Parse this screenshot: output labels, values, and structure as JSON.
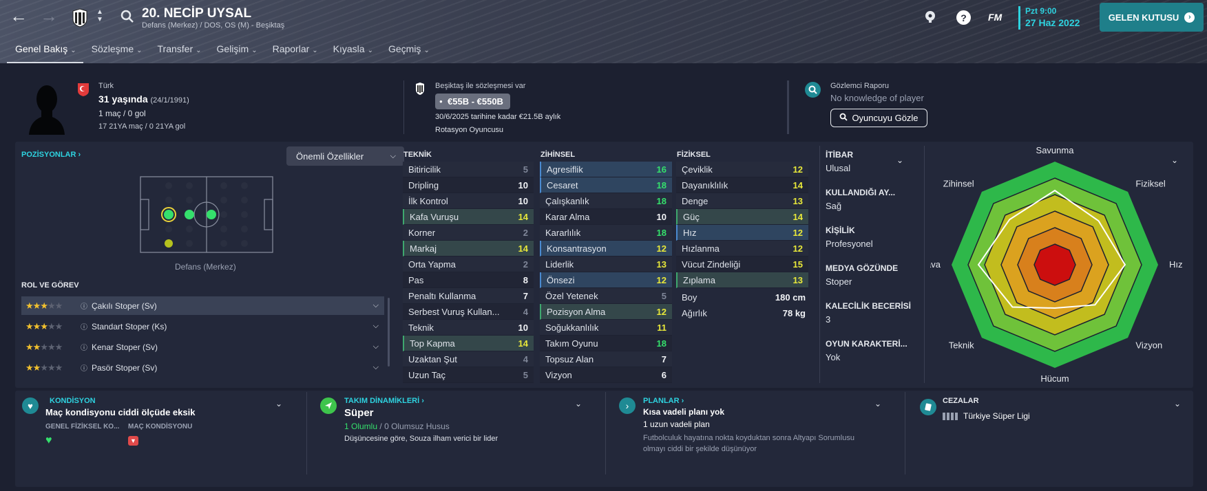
{
  "header": {
    "player_title": "20. NECİP UYSAL",
    "player_subtitle": "Defans (Merkez) / DOS, OS (M) - Beşiktaş",
    "tabs": [
      "Genel Bakış",
      "Sözleşme",
      "Transfer",
      "Gelişim",
      "Raporlar",
      "Kıyasla",
      "Geçmiş"
    ],
    "fm_label": "FM",
    "date_line1": "Pzt 9:00",
    "date_line2": "27 Haz 2022",
    "inbox_label": "GELEN KUTUSU"
  },
  "profile": {
    "nationality": "Türk",
    "age": "31 yaşında",
    "birth": "(24/1/1991)",
    "caps": "1 maç / 0 gol",
    "u21": "17 21YA maç / 0 21YA gol"
  },
  "contract": {
    "text": "Beşiktaş ile sözleşmesi var",
    "value_range": "€55B - €550B",
    "wage": "30/6/2025 tarihine kadar €21.5B aylık",
    "role": "Rotasyon Oyuncusu"
  },
  "scout": {
    "title": "Gözlemci Raporu",
    "text": "No knowledge of player",
    "button": "Oyuncuyu Gözle"
  },
  "positions": {
    "title": "POZİSYONLAR",
    "dropdown": "Önemli Özellikler",
    "pitch_caption": "Defans (Merkez)",
    "roles_title": "ROL VE GÖREV",
    "roles": [
      {
        "name": "Çakılı Stoper (Sv)",
        "stars": 2.5
      },
      {
        "name": "Standart Stoper (Ks)",
        "stars": 2.5
      },
      {
        "name": "Kenar Stoper (Sv)",
        "stars": 2
      },
      {
        "name": "Pasör Stoper (Sv)",
        "stars": 2
      }
    ]
  },
  "teknik": {
    "title": "TEKNİK",
    "rows": [
      {
        "name": "Bitiricilik",
        "value": "5",
        "hl": "plain"
      },
      {
        "name": "Dripling",
        "value": "10",
        "hl": "alt"
      },
      {
        "name": "İlk Kontrol",
        "value": "10",
        "hl": "plain"
      },
      {
        "name": "Kafa Vuruşu",
        "value": "14",
        "hl": "green"
      },
      {
        "name": "Korner",
        "value": "2",
        "hl": "plain"
      },
      {
        "name": "Markaj",
        "value": "14",
        "hl": "green"
      },
      {
        "name": "Orta Yapma",
        "value": "2",
        "hl": "plain"
      },
      {
        "name": "Pas",
        "value": "8",
        "hl": "alt"
      },
      {
        "name": "Penaltı Kullanma",
        "value": "7",
        "hl": "plain"
      },
      {
        "name": "Serbest Vuruş Kullan...",
        "value": "4",
        "hl": "alt"
      },
      {
        "name": "Teknik",
        "value": "10",
        "hl": "plain"
      },
      {
        "name": "Top Kapma",
        "value": "14",
        "hl": "green"
      },
      {
        "name": "Uzaktan Şut",
        "value": "4",
        "hl": "plain"
      },
      {
        "name": "Uzun Taç",
        "value": "5",
        "hl": "alt"
      }
    ]
  },
  "zihinsel": {
    "title": "ZİHİNSEL",
    "rows": [
      {
        "name": "Agresiflik",
        "value": "16",
        "hl": "blue"
      },
      {
        "name": "Cesaret",
        "value": "18",
        "hl": "blue"
      },
      {
        "name": "Çalışkanlık",
        "value": "18",
        "hl": "plain"
      },
      {
        "name": "Karar Alma",
        "value": "10",
        "hl": "alt"
      },
      {
        "name": "Kararlılık",
        "value": "18",
        "hl": "plain"
      },
      {
        "name": "Konsantrasyon",
        "value": "12",
        "hl": "blue"
      },
      {
        "name": "Liderlik",
        "value": "13",
        "hl": "plain"
      },
      {
        "name": "Önsezi",
        "value": "12",
        "hl": "blue"
      },
      {
        "name": "Özel Yetenek",
        "value": "5",
        "hl": "plain"
      },
      {
        "name": "Pozisyon Alma",
        "value": "12",
        "hl": "green"
      },
      {
        "name": "Soğukkanlılık",
        "value": "11",
        "hl": "plain"
      },
      {
        "name": "Takım Oyunu",
        "value": "18",
        "hl": "alt"
      },
      {
        "name": "Topsuz Alan",
        "value": "7",
        "hl": "plain"
      },
      {
        "name": "Vizyon",
        "value": "6",
        "hl": "alt"
      }
    ]
  },
  "fiziksel": {
    "title": "FİZİKSEL",
    "rows": [
      {
        "name": "Çeviklik",
        "value": "12",
        "hl": "plain"
      },
      {
        "name": "Dayanıklılık",
        "value": "14",
        "hl": "alt"
      },
      {
        "name": "Denge",
        "value": "13",
        "hl": "plain"
      },
      {
        "name": "Güç",
        "value": "14",
        "hl": "green"
      },
      {
        "name": "Hız",
        "value": "12",
        "hl": "blue"
      },
      {
        "name": "Hızlanma",
        "value": "12",
        "hl": "plain"
      },
      {
        "name": "Vücut Zindeliği",
        "value": "15",
        "hl": "alt"
      },
      {
        "name": "Zıplama",
        "value": "13",
        "hl": "green"
      }
    ],
    "height_label": "Boy",
    "height": "180 cm",
    "weight_label": "Ağırlık",
    "weight": "78 kg"
  },
  "info": [
    {
      "label": "İTİBAR",
      "value": "Ulusal"
    },
    {
      "label": "KULLANDIĞI AY...",
      "value": "Sağ"
    },
    {
      "label": "KİŞİLİK",
      "value": "Profesyonel"
    },
    {
      "label": "MEDYA GÖZÜNDE",
      "value": "Stoper"
    },
    {
      "label": "KALECİLİK BECERİSİ",
      "value": "3"
    },
    {
      "label": "OYUN KARAKTERİ...",
      "value": "Yok"
    }
  ],
  "radar": {
    "labels": [
      "Savunma",
      "Fiziksel",
      "Hız",
      "Vizyon",
      "Hücum",
      "Teknik",
      "Hava",
      "Zihinsel"
    ],
    "values": [
      0.72,
      0.6,
      0.68,
      0.55,
      0.42,
      0.58,
      0.74,
      0.62
    ]
  },
  "bottom": {
    "kondisyon": {
      "title": "KONDİSYON",
      "text": "Maç kondisyonu ciddi ölçüde eksik",
      "sub1": "GENEL FİZİKSEL KO...",
      "sub2": "MAÇ KONDİSYONU"
    },
    "takim": {
      "title": "TAKIM DİNAMİKLERİ",
      "value": "Süper",
      "positive": "1 Olumlu",
      "sep": "/",
      "negative": "0 Olumsuz Husus",
      "text": "Düşüncesine göre, Souza ilham verici bir lider"
    },
    "planlar": {
      "title": "PLANLAR",
      "line1": "Kısa vadeli planı yok",
      "line2": "1 uzun vadeli plan",
      "line3": "Futbolculuk hayatına nokta koyduktan sonra Altyapı Sorumlusu olmayı ciddi bir şekilde düşünüyor"
    },
    "cezalar": {
      "title": "CEZALAR",
      "text": "Türkiye Süper Ligi"
    }
  },
  "colors": {
    "accent": "#1f7f8a",
    "cyan": "#2ed3e0",
    "green": "#35e06c",
    "yellow": "#e8e83a"
  }
}
